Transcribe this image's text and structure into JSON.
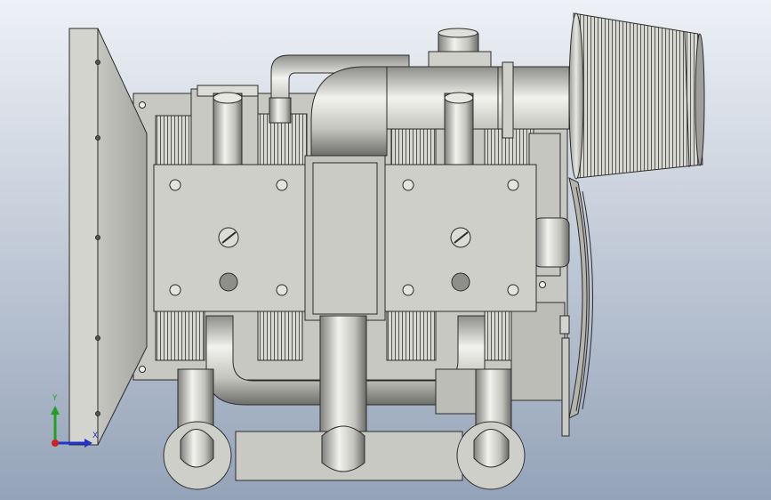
{
  "viewport": {
    "background_top": "#e8ecf2",
    "background_bottom": "#96a4b8",
    "model_color": "#c9c9c4",
    "edge_color": "#2b2b2b"
  },
  "triad": {
    "y_label": "Y",
    "x_label": "X",
    "y_color": "#22a022",
    "x_color": "#2233cc",
    "z_color": "#cc2222"
  }
}
